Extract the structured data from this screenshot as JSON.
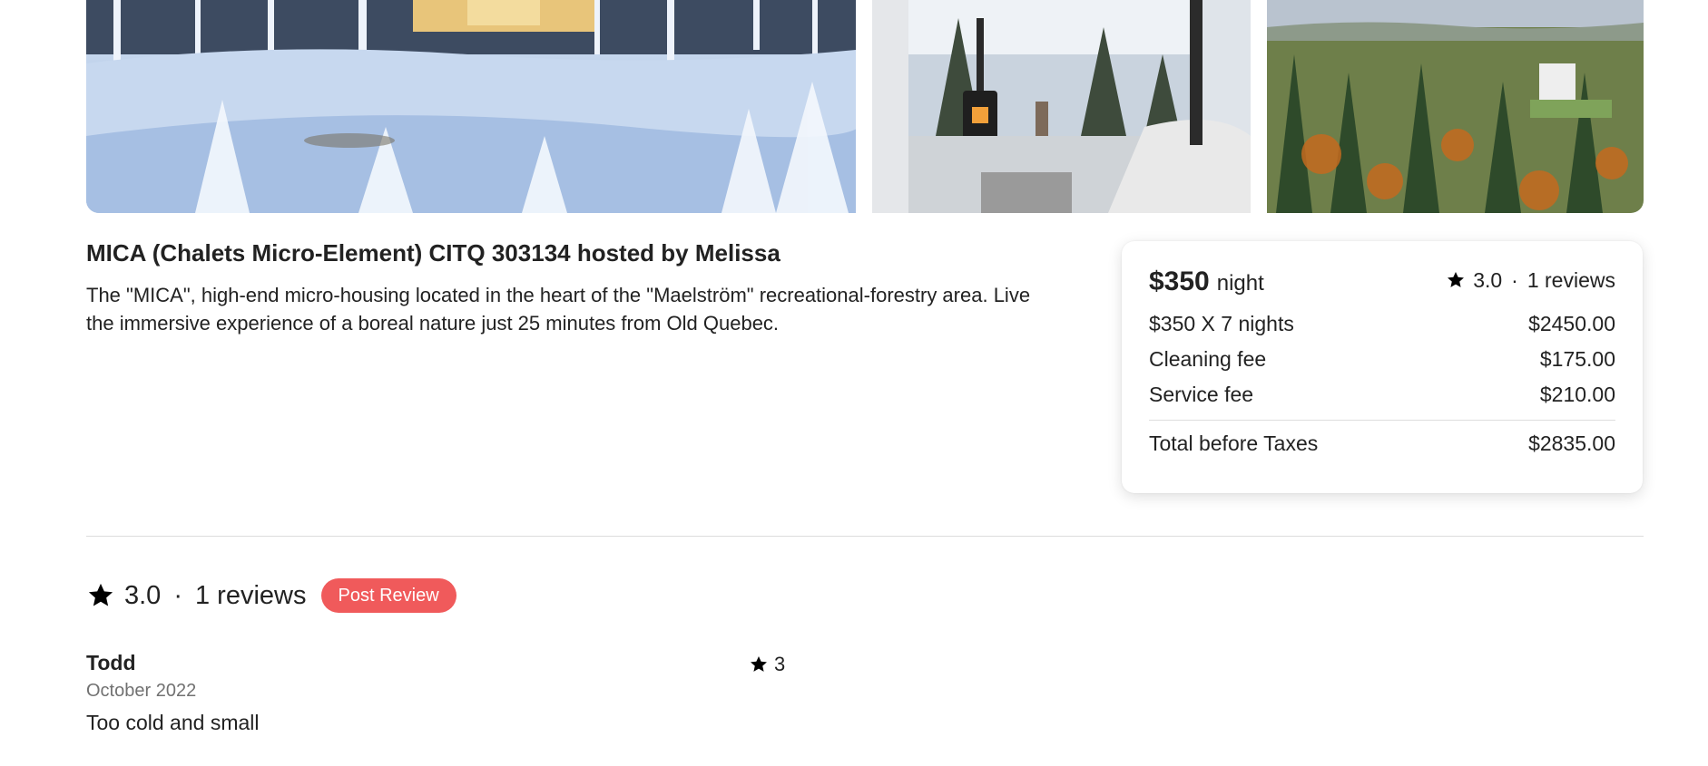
{
  "listing": {
    "title": "MICA (Chalets Micro-Element) CITQ 303134 hosted by Melissa",
    "description": "The \"MICA\", high-end micro-housing located in the heart of the \"Maelström\" recreational-forestry area. Live the immersive experience of a boreal nature just 25 minutes from Old Quebec."
  },
  "booking": {
    "price": "$350",
    "per": "night",
    "rating": "3.0",
    "separator": "·",
    "reviews": "1 reviews",
    "lines": [
      {
        "label": "$350 X 7 nights",
        "amount": "$2450.00"
      },
      {
        "label": "Cleaning fee",
        "amount": "$175.00"
      },
      {
        "label": "Service fee",
        "amount": "$210.00"
      }
    ],
    "total": {
      "label": "Total before Taxes",
      "amount": "$2835.00"
    }
  },
  "reviews_section": {
    "rating": "3.0",
    "separator": "·",
    "count": "1 reviews",
    "post_button": "Post Review"
  },
  "reviews": [
    {
      "name": "Todd",
      "date": "October 2022",
      "stars": "3",
      "text": "Too cold and small"
    }
  ],
  "colors": {
    "accent": "#f05a5b",
    "text": "#222222",
    "muted": "#717171",
    "divider": "#dddddd"
  },
  "icons": {
    "star": "star-icon"
  }
}
